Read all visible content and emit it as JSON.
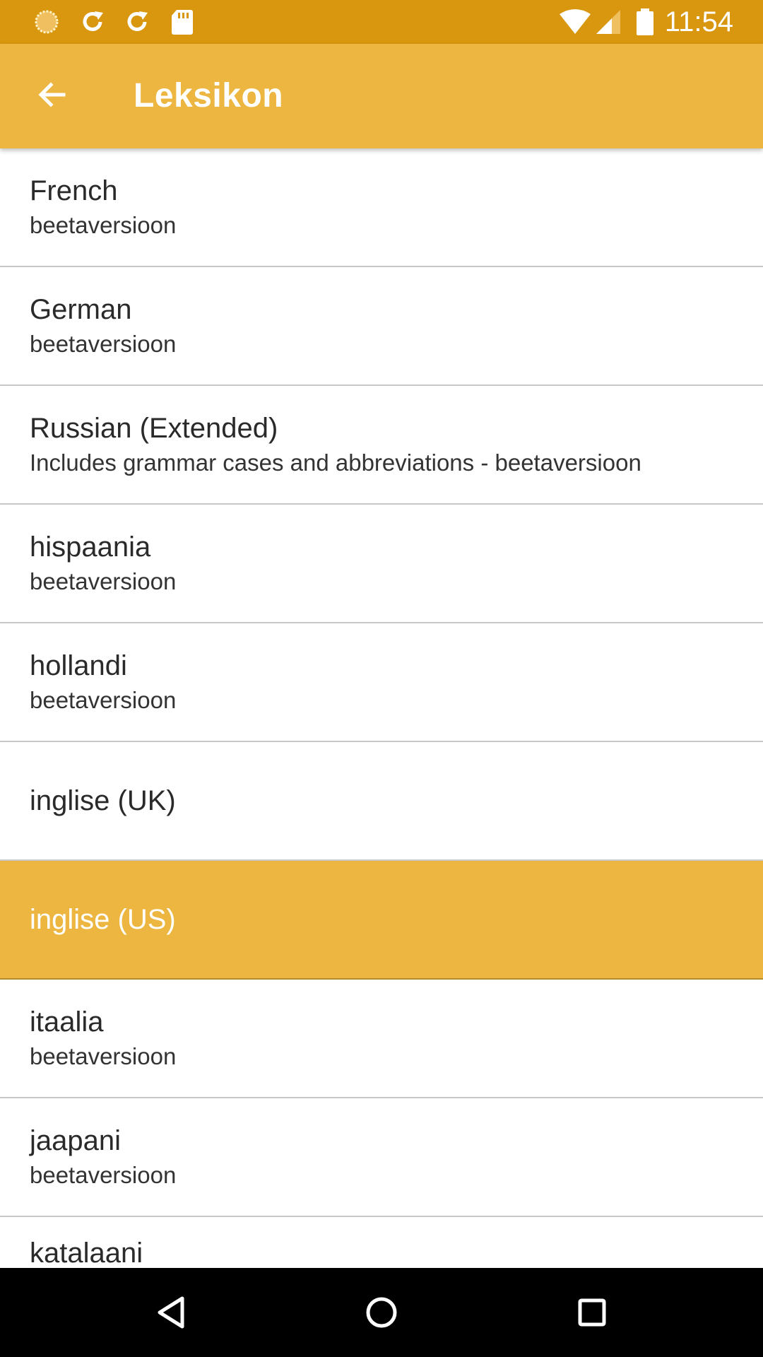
{
  "status_bar": {
    "time": "11:54",
    "left_icons": [
      "sync-indicator-icon",
      "refresh-icon",
      "refresh-icon",
      "sd-card-icon"
    ],
    "right_icons": [
      "wifi-icon",
      "cellular-signal-icon",
      "battery-icon"
    ]
  },
  "app_bar": {
    "title": "Leksikon",
    "back_icon": "arrow-back-icon"
  },
  "list": {
    "items": [
      {
        "title": "French",
        "subtitle": "beetaversioon"
      },
      {
        "title": "German",
        "subtitle": "beetaversioon"
      },
      {
        "title": "Russian (Extended)",
        "subtitle": "Includes grammar cases and abbreviations - beetaversioon"
      },
      {
        "title": "hispaania",
        "subtitle": "beetaversioon"
      },
      {
        "title": "hollandi",
        "subtitle": "beetaversioon"
      },
      {
        "title": "inglise (UK)",
        "subtitle": ""
      },
      {
        "title": "inglise (US)",
        "subtitle": "",
        "selected": true
      },
      {
        "title": "itaalia",
        "subtitle": "beetaversioon"
      },
      {
        "title": "jaapani",
        "subtitle": "beetaversioon"
      },
      {
        "title": "katalaani",
        "subtitle": ""
      }
    ]
  },
  "nav_bar": {
    "buttons": [
      "back-triangle-icon",
      "home-circle-icon",
      "recents-square-icon"
    ]
  },
  "colors": {
    "status_bar": "#d8970f",
    "app_bar": "#ecb640",
    "selected_row": "#ecb640",
    "divider": "#c8c8c8",
    "nav_bar": "#000000"
  }
}
